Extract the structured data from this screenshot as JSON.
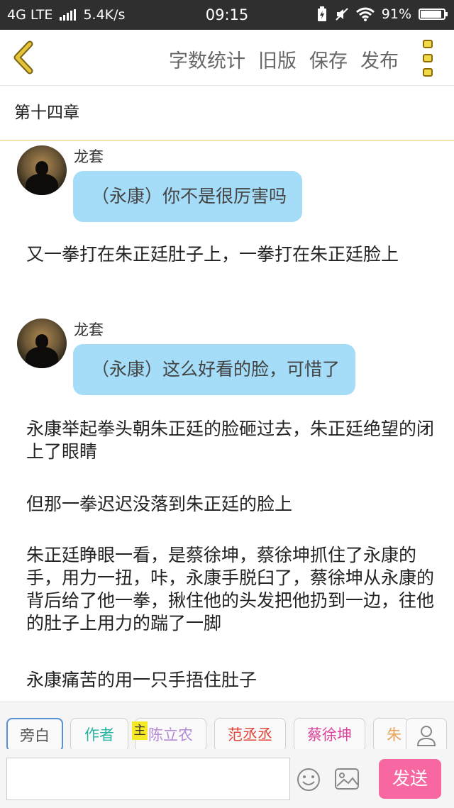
{
  "status_bar": {
    "network": "4G LTE",
    "speed": "5.4K/s",
    "time": "09:15",
    "battery": "91%",
    "battery_level": 0.91
  },
  "nav": {
    "word_count": "字数统计",
    "old_version": "旧版",
    "save": "保存",
    "publish": "发布"
  },
  "chapter": {
    "title": "第十四章"
  },
  "messages": [
    {
      "type": "dialogue",
      "sender": "龙套",
      "text": "（永康）你不是很厉害吗"
    },
    {
      "type": "narration",
      "text": "又一拳打在朱正廷肚子上，一拳打在朱正廷脸上"
    },
    {
      "type": "dialogue",
      "sender": "龙套",
      "text": "（永康）这么好看的脸，可惜了"
    },
    {
      "type": "narration",
      "text": "永康举起拳头朝朱正廷的脸砸过去，朱正廷绝望的闭上了眼睛"
    },
    {
      "type": "narration",
      "text": "但那一拳迟迟没落到朱正廷的脸上"
    },
    {
      "type": "narration",
      "text": "朱正廷睁眼一看，是蔡徐坤，蔡徐坤抓住了永康的手，用力一扭，咔，永康手脱臼了，蔡徐坤从永康的背后给了他一拳，揪住他的头发把他扔到一边，往他的肚子上用力的踹了一脚"
    },
    {
      "type": "narration",
      "text": "永康痛苦的用一只手捂住肚子"
    }
  ],
  "roles": [
    {
      "label": "旁白",
      "color": "#666666"
    },
    {
      "label": "作者",
      "color": "#2bb3a3"
    },
    {
      "label": "陈立农",
      "color": "#b58ad6"
    },
    {
      "label": "范丞丞",
      "color": "#e0443a"
    },
    {
      "label": "蔡徐坤",
      "color": "#d9449a"
    },
    {
      "label": "朱",
      "color": "#e8a25a"
    }
  ],
  "main_badge": "主",
  "input": {
    "value": "",
    "placeholder": ""
  },
  "send_label": "发送",
  "colors": {
    "bubble": "#a5dcf8",
    "send": "#f768a2",
    "back_arrow": "#e3c43a",
    "status_bar": "#2f2f2f"
  }
}
